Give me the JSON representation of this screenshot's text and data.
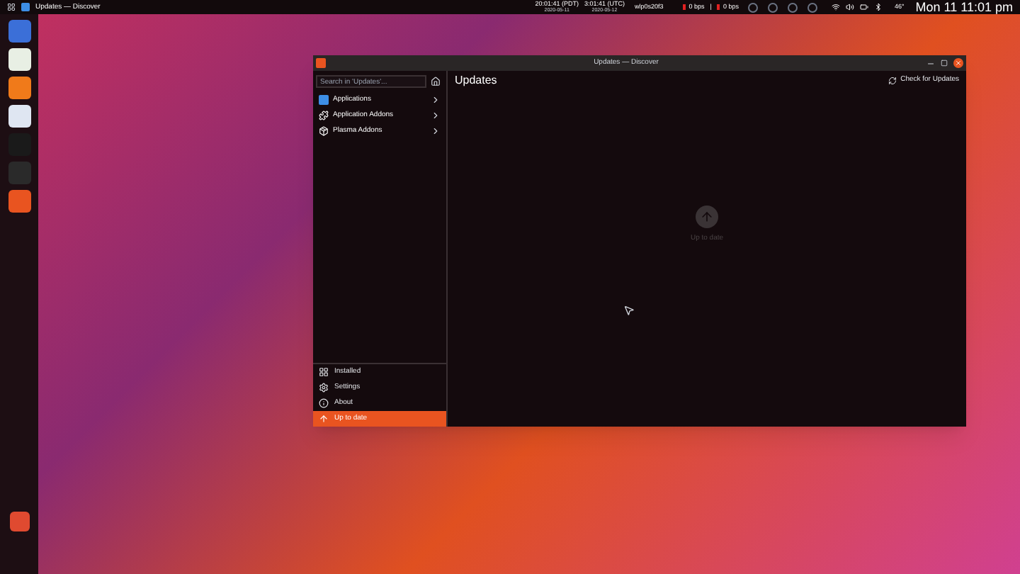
{
  "top_bar": {
    "app_title": "Updates — Discover",
    "clocks": [
      {
        "time": "20:01:41 (PDT)",
        "date": "2020-05-11"
      },
      {
        "time": "3:01:41 (UTC)",
        "date": "2020-05-12"
      }
    ],
    "network_interface": "wlp0s20f3",
    "download_rate": "0 bps",
    "separator": "|",
    "upload_rate": "0 bps",
    "temperature": "46°",
    "datetime": "Mon 11 11:01 pm"
  },
  "window": {
    "title": "Updates — Discover"
  },
  "sidebar": {
    "search": {
      "placeholder": "Search in 'Updates'..."
    },
    "categories": [
      {
        "label": "Applications"
      },
      {
        "label": "Application Addons"
      },
      {
        "label": "Plasma Addons"
      }
    ],
    "bottom_items": [
      {
        "label": "Installed",
        "selected": false
      },
      {
        "label": "Settings",
        "selected": false
      },
      {
        "label": "About",
        "selected": false
      },
      {
        "label": "Up to date",
        "selected": true
      }
    ]
  },
  "page": {
    "title": "Updates",
    "action": "Check for Updates",
    "status": "Up to date"
  }
}
